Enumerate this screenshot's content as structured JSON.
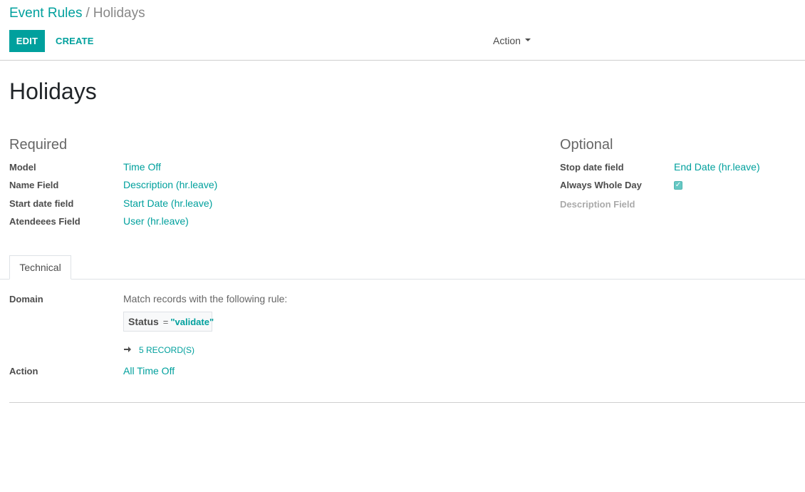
{
  "breadcrumb": {
    "parent": "Event Rules",
    "separator": "/",
    "current": "Holidays"
  },
  "toolbar": {
    "edit_label": "EDIT",
    "create_label": "CREATE",
    "action_label": "Action"
  },
  "record": {
    "title": "Holidays"
  },
  "required": {
    "title": "Required",
    "fields": [
      {
        "label": "Model",
        "value": "Time Off"
      },
      {
        "label": "Name Field",
        "value": "Description (hr.leave)"
      },
      {
        "label": "Start date field",
        "value": "Start Date (hr.leave)"
      },
      {
        "label": "Atendeees Field",
        "value": "User (hr.leave)"
      }
    ]
  },
  "optional": {
    "title": "Optional",
    "stop_date": {
      "label": "Stop date field",
      "value": "End Date (hr.leave)"
    },
    "whole_day": {
      "label": "Always Whole Day",
      "checked": true
    },
    "description": {
      "label": "Description Field"
    }
  },
  "tabs": [
    {
      "label": "Technical",
      "active": true
    }
  ],
  "technical": {
    "domain_label": "Domain",
    "domain_description": "Match records with the following rule:",
    "rule": {
      "field": "Status",
      "operator": "=",
      "value": "\"validate\""
    },
    "records_link": "5 RECORD(S)",
    "action_label": "Action",
    "action_value": "All Time Off"
  },
  "colors": {
    "accent": "#00a09d",
    "text": "#4c4c4c",
    "muted": "#aaaaaa"
  },
  "icons": {
    "records_arrow": "arrow-right-icon",
    "action_caret": "caret-down-icon",
    "checkbox": "checkmark-icon"
  }
}
